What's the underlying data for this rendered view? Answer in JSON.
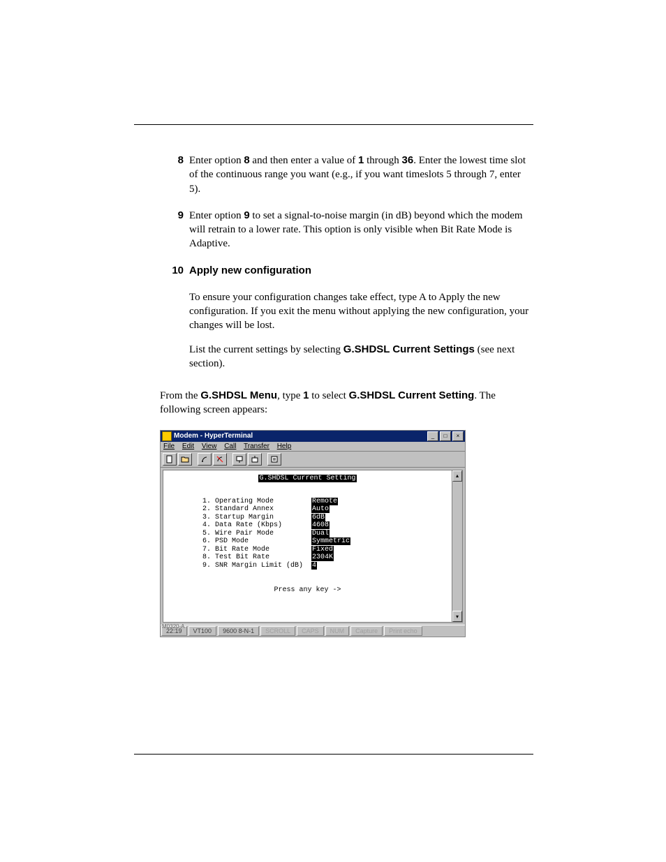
{
  "header_rule": true,
  "step8": {
    "num": "8",
    "text_a": "Enter option ",
    "bold_a": "8",
    "text_b": " and then enter a value of ",
    "bold_b": "1",
    "text_c": " through ",
    "bold_c": "36",
    "text_d": ". Enter the lowest time slot of the continuous range you want (e.g., if you want timeslots 5 through 7, enter 5)."
  },
  "step9": {
    "num": "9",
    "text_a": "Enter option ",
    "bold_a": "9",
    "text_b": " to set a signal-to-noise margin (in dB) beyond which the modem will retrain to a lower rate. This option is only visible when Bit Rate Mode is Adaptive."
  },
  "step10": {
    "num": "10",
    "bold": "Apply new configuration"
  },
  "apply_text": "To ensure your configuration changes take effect, type A to Apply the new configuration. If you exit the menu without applying the new configuration, your changes will be lost.",
  "list_label_a": "List the current settings by selecting ",
  "list_bold": "G.SHDSL Current Settings",
  "list_label_b": " (see next section).",
  "menu_line_a": "From the ",
  "menu_bold_a": "G.SHDSL Menu",
  "menu_b": ", type ",
  "menu_bold_b": "1",
  "menu_c": " to select ",
  "menu_bold_c": "G.SHDSL Current Setting",
  "menu_d": ". The following screen appears:",
  "term": {
    "title": "Modem - HyperTerminal",
    "menus": [
      "File",
      "Edit",
      "View",
      "Call",
      "Transfer",
      "Help"
    ],
    "header": "G.SHDSL Current Setting",
    "rows": [
      {
        "n": "1.",
        "label": "Operating Mode",
        "val": "Remote"
      },
      {
        "n": "2.",
        "label": "Standard Annex",
        "val": "Auto"
      },
      {
        "n": "3.",
        "label": "Startup Margin",
        "val": "6dB"
      },
      {
        "n": "4.",
        "label": "Data Rate (Kbps)",
        "val": "4608"
      },
      {
        "n": "5.",
        "label": "Wire Pair Mode",
        "val": "Dual"
      },
      {
        "n": "6.",
        "label": "PSD Mode",
        "val": "Symmetric"
      },
      {
        "n": "7.",
        "label": "Bit Rate Mode",
        "val": "Fixed"
      },
      {
        "n": "8.",
        "label": "Test Bit Rate",
        "val": "2304K"
      },
      {
        "n": "9.",
        "label": "SNR Margin Limit (dB)",
        "val": "4"
      }
    ],
    "press": "Press any key ->",
    "status": [
      "22:19",
      "VT100",
      "9600 8-N-1",
      "SCROLL",
      "CAPS",
      "NUM",
      "Capture",
      "Print echo"
    ],
    "corner": "M0320-A"
  }
}
